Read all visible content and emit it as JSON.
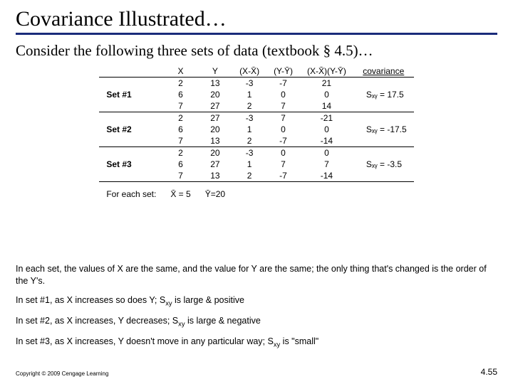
{
  "title": "Covariance Illustrated…",
  "subtitle": "Consider the following three sets of data (textbook § 4.5)…",
  "headers": {
    "x": "X",
    "y": "Y",
    "xdev": "(X-X̄)",
    "ydev": "(Y-Ȳ)",
    "prod": "(X-X̄)(Y-Ȳ)",
    "cov": "covariance"
  },
  "sets": [
    {
      "label": "Set #1",
      "rows": [
        {
          "x": "2",
          "y": "13",
          "xd": "-3",
          "yd": "-7",
          "p": "21"
        },
        {
          "x": "6",
          "y": "20",
          "xd": "1",
          "yd": "0",
          "p": "0"
        },
        {
          "x": "7",
          "y": "27",
          "xd": "2",
          "yd": "7",
          "p": "14"
        }
      ],
      "cov": "Sₓᵧ = 17.5"
    },
    {
      "label": "Set #2",
      "rows": [
        {
          "x": "2",
          "y": "27",
          "xd": "-3",
          "yd": "7",
          "p": "-21"
        },
        {
          "x": "6",
          "y": "20",
          "xd": "1",
          "yd": "0",
          "p": "0"
        },
        {
          "x": "7",
          "y": "13",
          "xd": "2",
          "yd": "-7",
          "p": "-14"
        }
      ],
      "cov": "Sₓᵧ = -17.5"
    },
    {
      "label": "Set #3",
      "rows": [
        {
          "x": "2",
          "y": "20",
          "xd": "-3",
          "yd": "0",
          "p": "0"
        },
        {
          "x": "6",
          "y": "27",
          "xd": "1",
          "yd": "7",
          "p": "7"
        },
        {
          "x": "7",
          "y": "13",
          "xd": "2",
          "yd": "-7",
          "p": "-14"
        }
      ],
      "cov": "Sₓᵧ = -3.5"
    }
  ],
  "means": {
    "label": "For each set:",
    "xmean": "X̄ = 5",
    "ymean": "Ȳ=20"
  },
  "notes": {
    "p1": "In each set, the values of X are the same, and the value for Y are the same; the only thing that's changed is the order of the Y's.",
    "p2_a": "In set #1, as X increases so does Y; S",
    "p2_b": " is large & positive",
    "p3_a": "In set #2, as X increases, Y decreases; S",
    "p3_b": " is large & negative",
    "p4_a": "In set #3, as X increases, Y doesn't move in any particular way; S",
    "p4_b": " is \"small\"",
    "sub": "xy"
  },
  "copyright": "Copyright © 2009 Cengage Learning",
  "pagenum": "4.55",
  "chart_data": {
    "type": "table",
    "title": "Covariance Illustrated",
    "xmean": 5,
    "ymean": 20,
    "series": [
      {
        "name": "Set #1",
        "x": [
          2,
          6,
          7
        ],
        "y": [
          13,
          20,
          27
        ],
        "xdev": [
          -3,
          1,
          2
        ],
        "ydev": [
          -7,
          0,
          7
        ],
        "prod": [
          21,
          0,
          14
        ],
        "covariance": 17.5
      },
      {
        "name": "Set #2",
        "x": [
          2,
          6,
          7
        ],
        "y": [
          27,
          20,
          13
        ],
        "xdev": [
          -3,
          1,
          2
        ],
        "ydev": [
          7,
          0,
          -7
        ],
        "prod": [
          -21,
          0,
          -14
        ],
        "covariance": -17.5
      },
      {
        "name": "Set #3",
        "x": [
          2,
          6,
          7
        ],
        "y": [
          20,
          27,
          13
        ],
        "xdev": [
          -3,
          1,
          2
        ],
        "ydev": [
          0,
          7,
          -7
        ],
        "prod": [
          0,
          7,
          -14
        ],
        "covariance": -3.5
      }
    ]
  }
}
